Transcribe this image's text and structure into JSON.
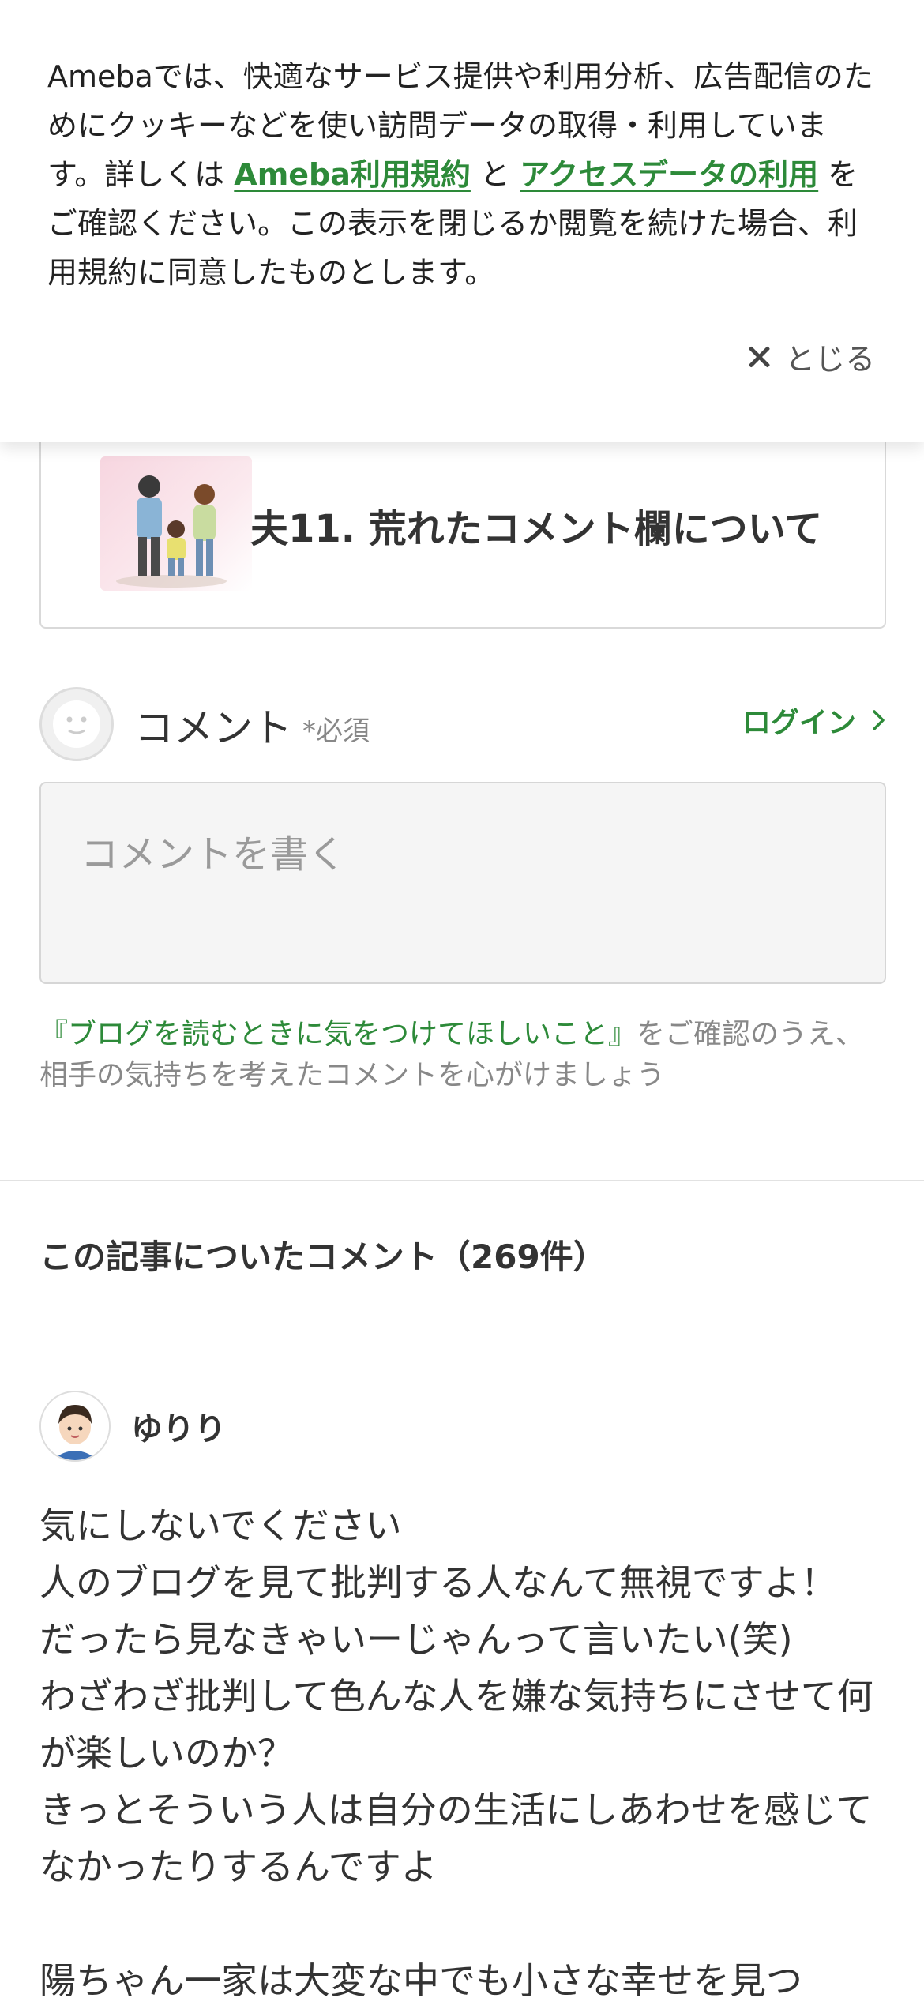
{
  "cookie_banner": {
    "text_before": "Amebaでは、快適なサービス提供や利用分析、広告配信のためにクッキーなどを使い訪問データの取得・利用しています。詳しくは ",
    "link_terms": "Ameba利用規約",
    "text_middle": " と ",
    "link_access_data": "アクセスデータの利用",
    "text_after": " をご確認ください。この表示を閉じるか閲覧を続けた場合、利用規約に同意したものとします。",
    "close_label": "とじる"
  },
  "article_card": {
    "title": "夫11. 荒れたコメント欄について"
  },
  "comment_form": {
    "label": "コメント",
    "required": "*必須",
    "login_label": "ログイン",
    "placeholder": "コメントを書く",
    "guideline_link": "『ブログを読むときに気をつけてほしいこと』",
    "guideline_text": "をご確認のうえ、相手の気持ちを考えたコメントを心がけましょう"
  },
  "comments": {
    "heading": "この記事についたコメント（269件）",
    "items": [
      {
        "author": "ゆりり",
        "body": "気にしないでください\n人のブログを見て批判する人なんて無視ですよ！\nだったら見なきゃいーじゃんって言いたい(笑)\nわざわざ批判して色んな人を嫌な気持ちにさせて何が楽しいのか？\nきっとそういう人は自分の生活にしあわせを感じてなかったりするんですよ\n\n陽ちゃん一家は大変な中でも小さな幸せを見つ"
      }
    ]
  },
  "colors": {
    "accent_green": "#2d8a39",
    "muted_text": "#888888"
  }
}
